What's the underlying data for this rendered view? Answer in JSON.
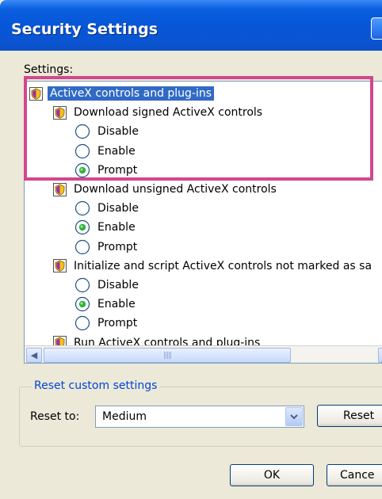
{
  "window": {
    "title": "Security Settings",
    "help_button": "?"
  },
  "settings_label": "Settings:",
  "tree": {
    "group_label": "ActiveX controls and plug-ins",
    "items": [
      {
        "label": "Download signed ActiveX controls",
        "options": [
          {
            "label": "Disable",
            "selected": false
          },
          {
            "label": "Enable",
            "selected": false
          },
          {
            "label": "Prompt",
            "selected": true
          }
        ]
      },
      {
        "label": "Download unsigned ActiveX controls",
        "options": [
          {
            "label": "Disable",
            "selected": false
          },
          {
            "label": "Enable",
            "selected": true
          },
          {
            "label": "Prompt",
            "selected": false
          }
        ]
      },
      {
        "label": "Initialize and script ActiveX controls not marked as sa",
        "options": [
          {
            "label": "Disable",
            "selected": false
          },
          {
            "label": "Enable",
            "selected": true
          },
          {
            "label": "Prompt",
            "selected": false
          }
        ]
      },
      {
        "label": "Run ActiveX controls and plug-ins",
        "options": []
      }
    ]
  },
  "reset_group": {
    "legend": "Reset custom settings",
    "reset_to_label": "Reset to:",
    "selected_level": "Medium",
    "reset_button": "Reset"
  },
  "buttons": {
    "ok": "OK",
    "cancel": "Cance"
  },
  "colors": {
    "title_bar": "#0a55d3",
    "selection": "#316ac5",
    "highlight_box": "#d1478f",
    "radio_selected": "#2fb33b",
    "legend_text": "#0046d5"
  }
}
